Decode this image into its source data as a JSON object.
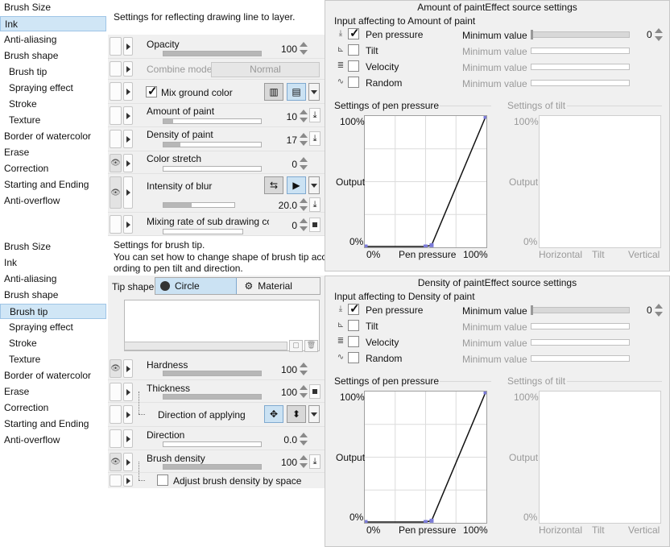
{
  "sidebar_top": {
    "items": [
      "Brush Size",
      "Ink",
      "Anti-aliasing",
      "Brush shape",
      "Brush tip",
      "Spraying effect",
      "Stroke",
      "Texture",
      "Border of watercolor",
      "Erase",
      "Correction",
      "Starting and Ending",
      "Anti-overflow"
    ],
    "selected": "Ink"
  },
  "sidebar_bottom": {
    "items": [
      "Brush Size",
      "Ink",
      "Anti-aliasing",
      "Brush shape",
      "Brush tip",
      "Spraying effect",
      "Stroke",
      "Texture",
      "Border of watercolor",
      "Erase",
      "Correction",
      "Starting and Ending",
      "Anti-overflow"
    ],
    "selected": "Brush tip"
  },
  "ink_panel": {
    "description": "Settings for reflecting drawing line to layer.",
    "opacity": {
      "label": "Opacity",
      "value": "100",
      "level": 1.0
    },
    "combine_mode": {
      "label": "Combine mode",
      "value": "Normal"
    },
    "mix_ground_color": {
      "label": "Mix ground color",
      "checked": true
    },
    "amount_of_paint": {
      "label": "Amount of paint",
      "value": "10",
      "level": 0.1
    },
    "density_of_paint": {
      "label": "Density of paint",
      "value": "17",
      "level": 0.17
    },
    "color_stretch": {
      "label": "Color stretch",
      "value": "0",
      "level": 0.0
    },
    "intensity_of_blur": {
      "label": "Intensity of blur",
      "value": "20.0",
      "level": 0.4
    },
    "mixing_rate": {
      "label": "Mixing rate of sub drawing colo",
      "value": "0",
      "level": 0.0
    }
  },
  "brushtip_panel": {
    "description_line1": "Settings for brush tip.",
    "description_line2": "You can set how to change shape of brush tip acc",
    "description_line3": "ording to pen tilt and direction.",
    "tip_shape_label": "Tip shape",
    "tab_circle": "Circle",
    "tab_material": "Material",
    "hardness": {
      "label": "Hardness",
      "value": "100",
      "level": 1.0
    },
    "thickness": {
      "label": "Thickness",
      "value": "100",
      "level": 1.0
    },
    "direction_of_applying": {
      "label": "Direction of applying"
    },
    "direction": {
      "label": "Direction",
      "value": "0.0",
      "level": 0.0
    },
    "brush_density": {
      "label": "Brush density",
      "value": "100",
      "level": 1.0
    },
    "adjust_density": {
      "label": "Adjust brush density by space",
      "checked": false
    }
  },
  "amount_dialog": {
    "title": "Amount of paintEffect source settings",
    "input_heading": "Input affecting to Amount of paint",
    "rows": [
      {
        "name": "Pen pressure",
        "checked": true,
        "min_label": "Minimum value",
        "min_value": "0",
        "active": true
      },
      {
        "name": "Tilt",
        "checked": false,
        "min_label": "Minimum value",
        "active": false
      },
      {
        "name": "Velocity",
        "checked": false,
        "min_label": "Minimum value",
        "active": false
      },
      {
        "name": "Random",
        "checked": false,
        "min_label": "Minimum value",
        "active": false
      }
    ],
    "pressure_heading": "Settings of pen pressure",
    "tilt_heading": "Settings of tilt",
    "y_top": "100%",
    "y_mid": "Output",
    "y_bottom": "0%",
    "x_left": "0%",
    "x_mid": "Pen pressure",
    "x_right": "100%",
    "tilt_y_top": "100%",
    "tilt_y_mid": "Output",
    "tilt_y_bottom": "0%",
    "tilt_x_left": "Horizontal",
    "tilt_x_mid": "Tilt",
    "tilt_x_right": "Vertical"
  },
  "density_dialog": {
    "title": "Density of paintEffect source settings",
    "input_heading": "Input affecting to Density of paint",
    "rows": [
      {
        "name": "Pen pressure",
        "checked": true,
        "min_label": "Minimum value",
        "min_value": "0",
        "active": true
      },
      {
        "name": "Tilt",
        "checked": false,
        "min_label": "Minimum value",
        "active": false
      },
      {
        "name": "Velocity",
        "checked": false,
        "min_label": "Minimum value",
        "active": false
      },
      {
        "name": "Random",
        "checked": false,
        "min_label": "Minimum value",
        "active": false
      }
    ],
    "pressure_heading": "Settings of pen pressure",
    "tilt_heading": "Settings of tilt",
    "y_top": "100%",
    "y_mid": "Output",
    "y_bottom": "0%",
    "x_left": "0%",
    "x_mid": "Pen pressure",
    "x_right": "100%",
    "tilt_y_top": "100%",
    "tilt_y_mid": "Output",
    "tilt_y_bottom": "0%",
    "tilt_x_left": "Horizontal",
    "tilt_x_mid": "Tilt",
    "tilt_x_right": "Vertical"
  },
  "pressure_curve": [
    [
      0,
      0
    ],
    [
      0.5,
      0
    ],
    [
      0.55,
      0.01
    ],
    [
      1,
      1
    ]
  ],
  "colors": {
    "selection": "#d0e6f6",
    "panel": "#f0f0f0",
    "curve_point": "#7b7bd8"
  }
}
